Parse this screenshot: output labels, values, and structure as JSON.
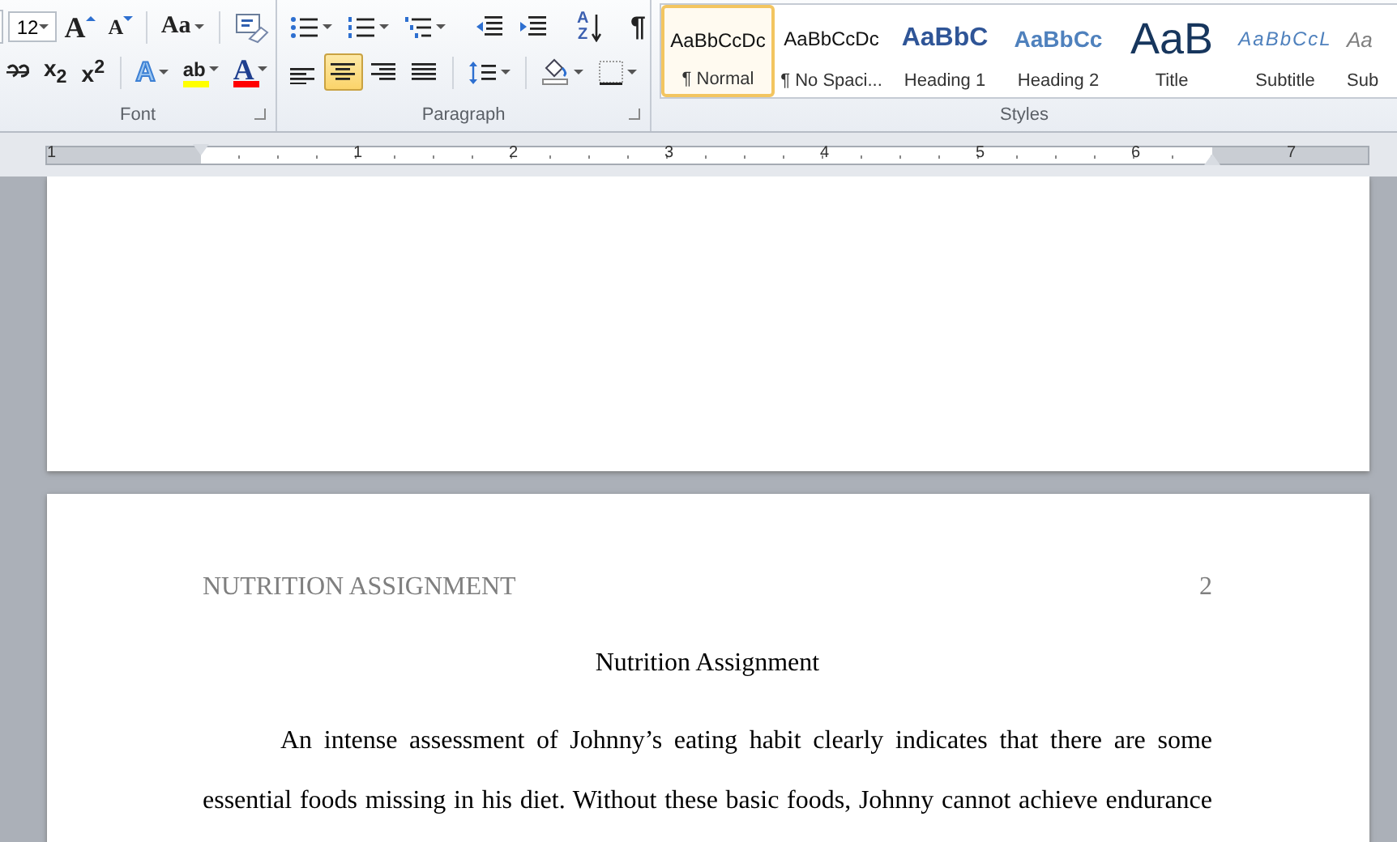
{
  "ribbon": {
    "font_group": {
      "label": "Font",
      "font_size": "12",
      "row1": [
        {
          "kind": "grow-font",
          "glyph": "A"
        },
        {
          "kind": "shrink-font",
          "glyph": "A"
        },
        {
          "kind": "sep"
        },
        {
          "kind": "change-case",
          "glyph": "Aa",
          "dropdown": true
        },
        {
          "kind": "sep"
        },
        {
          "kind": "clear-format"
        }
      ],
      "row2": [
        {
          "kind": "strike"
        },
        {
          "kind": "subscript",
          "glyph": "x$_{2}$"
        },
        {
          "kind": "superscript",
          "glyph": "x$^{2}$"
        },
        {
          "kind": "sep"
        },
        {
          "kind": "text-effect",
          "glyph": "A",
          "dropdown": true
        },
        {
          "kind": "highlight",
          "glyph": "ab",
          "dropdown": true
        },
        {
          "kind": "font-color",
          "glyph": "A",
          "dropdown": true
        }
      ]
    },
    "paragraph_group": {
      "label": "Paragraph",
      "row1": [
        {
          "kind": "bullets",
          "dropdown": true
        },
        {
          "kind": "numbering",
          "dropdown": true
        },
        {
          "kind": "multilevel",
          "dropdown": true
        },
        {
          "kind": "sep"
        },
        {
          "kind": "outdent"
        },
        {
          "kind": "indent"
        },
        {
          "kind": "sep"
        },
        {
          "kind": "sort",
          "glyph": "AZ"
        },
        {
          "kind": "sep"
        },
        {
          "kind": "pilcrow",
          "glyph": "¶"
        }
      ],
      "row2": [
        {
          "kind": "align-left",
          "selected": false
        },
        {
          "kind": "align-center",
          "selected": true
        },
        {
          "kind": "align-right",
          "selected": false
        },
        {
          "kind": "justify",
          "selected": false
        },
        {
          "kind": "sep"
        },
        {
          "kind": "line-spacing",
          "dropdown": true
        },
        {
          "kind": "sep"
        },
        {
          "kind": "shading",
          "dropdown": true
        },
        {
          "kind": "borders",
          "dropdown": true
        }
      ]
    },
    "styles_group": {
      "label": "Styles",
      "items": [
        {
          "kind": "normal",
          "sample": "AaBbCcDc",
          "label": "¶ Normal",
          "selected": true
        },
        {
          "kind": "normal",
          "sample": "AaBbCcDc",
          "label": "¶ No Spaci...",
          "selected": false
        },
        {
          "kind": "heading1",
          "sample": "AaBbC",
          "label": "Heading 1",
          "selected": false
        },
        {
          "kind": "heading2",
          "sample": "AaBbCc",
          "label": "Heading 2",
          "selected": false
        },
        {
          "kind": "title",
          "sample": "AaB",
          "label": "Title",
          "selected": false
        },
        {
          "kind": "subtitle",
          "sample": "AaBbCcL",
          "label": "Subtitle",
          "selected": false
        },
        {
          "kind": "subtle",
          "sample": "Aa",
          "label": "Sub",
          "selected": false
        }
      ]
    }
  },
  "ruler": {
    "numbers": [
      "1",
      "1",
      "2",
      "3",
      "4",
      "5",
      "6",
      "7"
    ]
  },
  "document": {
    "header": "NUTRITION ASSIGNMENT",
    "page_number": "2",
    "title": "Nutrition Assignment",
    "paragraph": "An intense assessment of Johnny’s eating habit clearly indicates that there are some essential foods missing in his diet. Without these basic foods, Johnny cannot achieve endurance"
  }
}
